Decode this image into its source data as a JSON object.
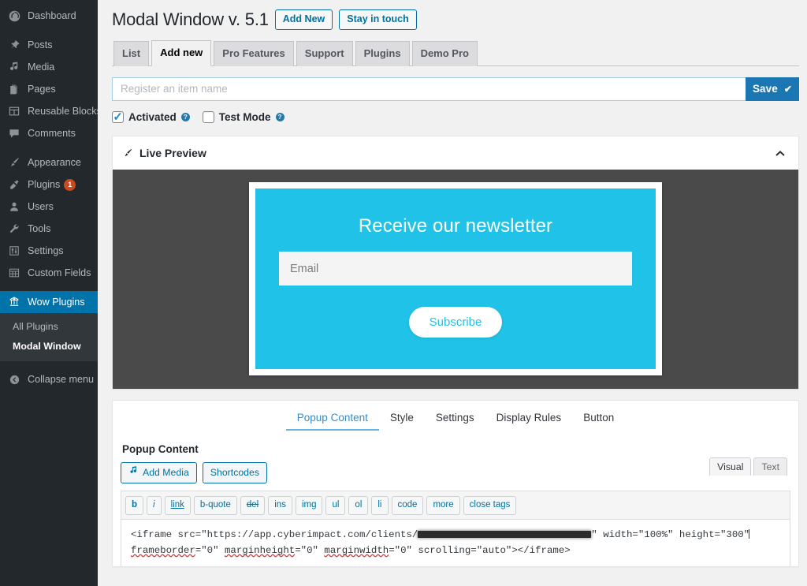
{
  "sidebar": {
    "items": [
      {
        "label": "Dashboard",
        "icon": "dashboard-icon",
        "current": false
      },
      {
        "label": "Posts",
        "icon": "pin-icon",
        "current": false
      },
      {
        "label": "Media",
        "icon": "media-icon",
        "current": false
      },
      {
        "label": "Pages",
        "icon": "pages-icon",
        "current": false
      },
      {
        "label": "Reusable Blocks",
        "icon": "blocks-icon",
        "current": false
      },
      {
        "label": "Comments",
        "icon": "comment-icon",
        "current": false
      },
      {
        "label": "Appearance",
        "icon": "brush-icon",
        "current": false
      },
      {
        "label": "Plugins",
        "icon": "plug-icon",
        "current": false,
        "badge": "1"
      },
      {
        "label": "Users",
        "icon": "user-icon",
        "current": false
      },
      {
        "label": "Tools",
        "icon": "wrench-icon",
        "current": false
      },
      {
        "label": "Settings",
        "icon": "settings-icon",
        "current": false
      },
      {
        "label": "Custom Fields",
        "icon": "custom-fields-icon",
        "current": false
      },
      {
        "label": "Wow Plugins",
        "icon": "wow-plugins-icon",
        "current": true
      }
    ],
    "submenu": [
      {
        "label": "All Plugins",
        "current": false
      },
      {
        "label": "Modal Window",
        "current": true
      }
    ],
    "collapse": {
      "label": "Collapse menu",
      "icon": "collapse-icon"
    }
  },
  "header": {
    "title": "Modal Window v. 5.1",
    "actions": [
      {
        "label": "Add New"
      },
      {
        "label": "Stay in touch"
      }
    ]
  },
  "tabs": [
    {
      "label": "List",
      "active": false
    },
    {
      "label": "Add new",
      "active": true
    },
    {
      "label": "Pro Features",
      "active": false
    },
    {
      "label": "Support",
      "active": false
    },
    {
      "label": "Plugins",
      "active": false
    },
    {
      "label": "Demo Pro",
      "active": false
    }
  ],
  "name_row": {
    "placeholder": "Register an item name",
    "value": "",
    "save_label": "Save",
    "save_icon": "check-icon",
    "save_check": "✔"
  },
  "options": [
    {
      "label": "Activated",
      "checked": true,
      "help_icon": "help-icon",
      "help_glyph": "?"
    },
    {
      "label": "Test Mode",
      "checked": false,
      "help_icon": "help-icon",
      "help_glyph": "?"
    }
  ],
  "live_preview": {
    "title": "Live Preview",
    "icon": "brush-icon",
    "toggle_icon": "chevron-up-icon",
    "modal": {
      "heading": "Receive our newsletter",
      "email_placeholder": "Email",
      "email_value": "",
      "button_label": "Subscribe",
      "bg_color": "#21c2e8",
      "button_text_color": "#21c2e8",
      "stage_color": "#4a4a4a"
    }
  },
  "editor": {
    "sub_tabs": [
      {
        "label": "Popup Content",
        "active": true
      },
      {
        "label": "Style",
        "active": false
      },
      {
        "label": "Settings",
        "active": false
      },
      {
        "label": "Display Rules",
        "active": false
      },
      {
        "label": "Button",
        "active": false
      }
    ],
    "section_label": "Popup Content",
    "media_buttons": [
      {
        "label": "Add Media",
        "icon": "media-icon"
      },
      {
        "label": "Shortcodes",
        "icon": null
      }
    ],
    "mode_tabs": [
      {
        "label": "Visual",
        "active": true
      },
      {
        "label": "Text",
        "active": false
      }
    ],
    "quicktags": [
      "b",
      "i",
      "link",
      "b-quote",
      "del",
      "ins",
      "img",
      "ul",
      "ol",
      "li",
      "code",
      "more",
      "close tags"
    ],
    "code": {
      "part1": "<iframe src=\"https://app.cyberimpact.com/clients/",
      "redacted": true,
      "part2": "\" width=\"100%\" height=\"300\"",
      "line2_a": "frameborder",
      "line2_b": "=\"0\" ",
      "line2_c": "marginheight",
      "line2_d": "=\"0\" ",
      "line2_e": "marginwidth",
      "line2_f": "=\"0\" scrolling=\"auto\"></iframe>"
    }
  },
  "colors": {
    "wp_blue": "#0073aa",
    "save_blue": "#1b76b4",
    "sidebar_bg": "#23282d",
    "submenu_bg": "#32373c",
    "accent_cyan": "#21c2e8",
    "badge_red": "#ca4a1f"
  }
}
